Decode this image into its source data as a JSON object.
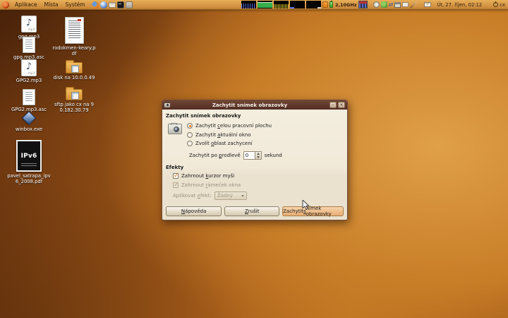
{
  "panel": {
    "menus": [
      {
        "label": "Aplikace"
      },
      {
        "label": "Místa"
      },
      {
        "label": "Systém"
      }
    ],
    "cpu_freq_label": "2,10GHz",
    "clock_label": "Út, 27. říjen, 02:12",
    "user_label": "cx"
  },
  "desktop_icons": [
    {
      "label": "gpg.mp3",
      "type": "audio",
      "badge": "mp3"
    },
    {
      "label": "gpg.mp3.asc",
      "type": "text"
    },
    {
      "label": "GPG2.mp3",
      "type": "audio",
      "badge": "mp3"
    },
    {
      "label": "GPG2.mp3.asc",
      "type": "text"
    },
    {
      "label": "winbox.exe",
      "type": "app"
    },
    {
      "label": "pavel_satrapa_ipv6_2008.pdf",
      "type": "book",
      "cover_text": "IPv6"
    },
    {
      "label": "rodokmen-keary.pdf",
      "type": "pdf-page"
    },
    {
      "label": "disk na 10.0.0.49",
      "type": "folder-remote"
    },
    {
      "label": "sftp jako cx na 90.182.30.79",
      "type": "folder-remote"
    }
  ],
  "dialog": {
    "title": "Zachytit snímek obrazovky",
    "window_controls": {
      "minimize": "–",
      "close": "×"
    },
    "heading": "Zachytit snímek obrazovky",
    "radios": [
      {
        "label": "Zachytit celou pracovní plochu",
        "selected": true
      },
      {
        "label": "Zachytit aktuální okno",
        "selected": false
      },
      {
        "label": "Zvolit oblast zachycení",
        "selected": false
      }
    ],
    "delay": {
      "label_before": "Zachytit po prodlevě",
      "value": "0",
      "label_after": "sekund"
    },
    "effects_heading": "Efekty",
    "checkboxes": [
      {
        "label": "Zahrnout kurzor myši",
        "checked": true,
        "enabled": true
      },
      {
        "label": "Zahrnout rámeček okna",
        "checked": true,
        "enabled": false
      }
    ],
    "apply_effect": {
      "label": "Aplikovat efekt:",
      "value": "Žádný",
      "enabled": false
    },
    "buttons": {
      "help": "Nápověda",
      "cancel": "Zrušit",
      "capture": "Zachytit snímek obrazovky"
    }
  },
  "colors": {
    "accent_orange": "#e36d00",
    "titlebar_brown": "#5d3a2c",
    "panel_tan": "#d9964a",
    "dialog_bg": "#efe7d7",
    "capture_button_hover": "#efbe8c"
  }
}
